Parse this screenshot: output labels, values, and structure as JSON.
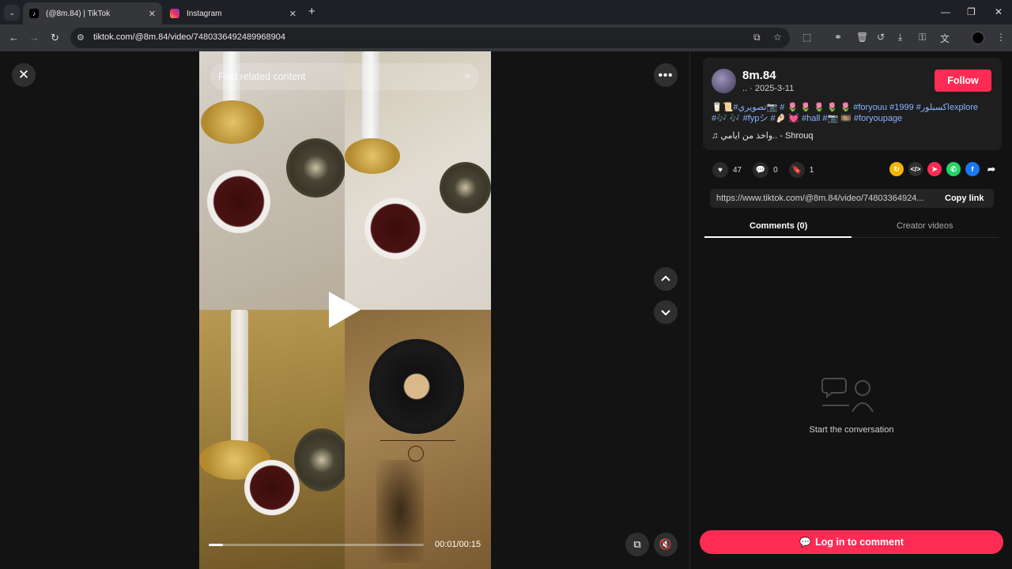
{
  "browser": {
    "tabs": [
      {
        "title": "(@8m.84) | TikTok"
      },
      {
        "title": "Instagram"
      }
    ],
    "url": "tiktok.com/@8m.84/video/7480336492489968904"
  },
  "video": {
    "search_placeholder": "Find related content",
    "time": "00:01/00:15",
    "progress": 0.067
  },
  "post": {
    "username": "8m.84",
    "subline": ".. · 2025-3-11",
    "follow_label": "Follow",
    "caption_line1": "🥛📜#تصويري📷 # 🌷 🌷 🌷 🌷 🌷 #foryouu #1999 #اكسبلورexplore",
    "caption_line2": "#🎶 🎶 #fypシ #🤌🏻 💓 #hall #📷 🎞️ #foryoupage",
    "music": "♫  واخذ من ايامي.. - Shrouq"
  },
  "stats": {
    "likes": "47",
    "comments": "0",
    "saves": "1"
  },
  "share": {
    "link": "https://www.tiktok.com/@8m.84/video/74803364924...",
    "copy_label": "Copy link"
  },
  "tabs": {
    "comments": "Comments (0)",
    "creator": "Creator videos"
  },
  "empty_state": "Start the conversation",
  "login_label": "Log in to comment",
  "colors": {
    "accent": "#fe2c55",
    "background": "#121212"
  }
}
